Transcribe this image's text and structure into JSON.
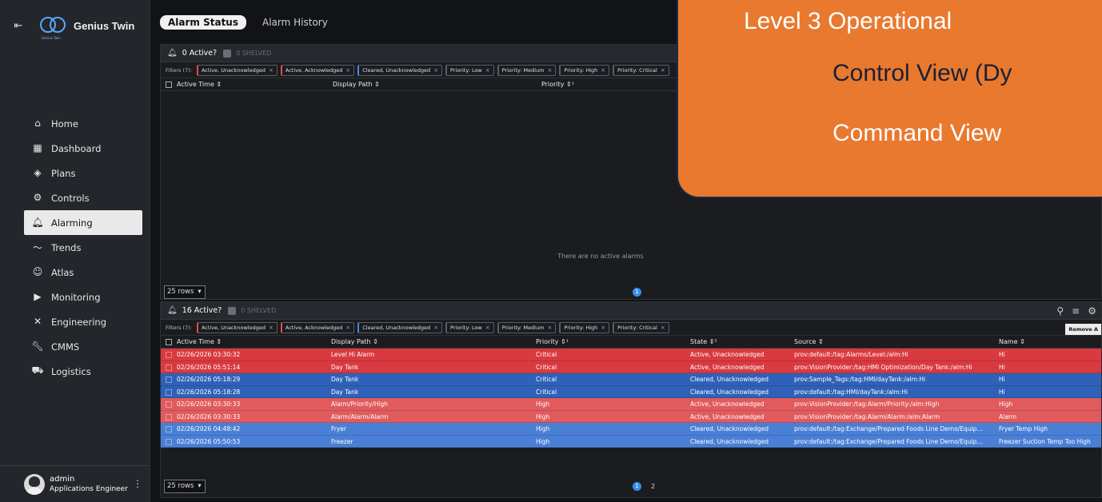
{
  "sidebar": {
    "collapse_icon": "arrow-left-icon",
    "brand": "Genius Twin",
    "logo_sub": "Genius Twin",
    "items": [
      {
        "label": "Home",
        "icon": "home-icon"
      },
      {
        "label": "Dashboard",
        "icon": "dashboard-icon"
      },
      {
        "label": "Plans",
        "icon": "layers-icon"
      },
      {
        "label": "Controls",
        "icon": "gears-icon"
      },
      {
        "label": "Alarming",
        "icon": "bell-icon",
        "active": true
      },
      {
        "label": "Trends",
        "icon": "trend-icon"
      },
      {
        "label": "Atlas",
        "icon": "users-icon"
      },
      {
        "label": "Monitoring",
        "icon": "camera-icon"
      },
      {
        "label": "Engineering",
        "icon": "tools-icon"
      },
      {
        "label": "CMMS",
        "icon": "wrench-icon"
      },
      {
        "label": "Logistics",
        "icon": "car-icon"
      }
    ],
    "user": {
      "name": "admin",
      "role": "Applications Engineer"
    }
  },
  "tabs": [
    {
      "label": "Alarm Status",
      "active": true
    },
    {
      "label": "Alarm History",
      "active": false
    }
  ],
  "panel1": {
    "active_label": "0 Active?",
    "shelved_label": "0 SHELVED",
    "filters_label": "Filters (7):",
    "chips": [
      "Active, Unacknowledged",
      "Active, Acknowledged",
      "Cleared, Unacknowledged",
      "Priority: Low",
      "Priority: Medium",
      "Priority: High",
      "Priority: Critical"
    ],
    "columns": [
      "Active Time",
      "Display Path",
      "Priority"
    ],
    "empty_message": "There are no active alarms",
    "rows_select": "25 rows",
    "pages": [
      "1"
    ]
  },
  "panel2": {
    "active_label": "16 Active?",
    "shelved_label": "0 SHELVED",
    "filters_label": "Filters (7):",
    "chips": [
      "Active, Unacknowledged",
      "Active, Acknowledged",
      "Cleared, Unacknowledged",
      "Priority: Low",
      "Priority: Medium",
      "Priority: High",
      "Priority: Critical"
    ],
    "remove_label": "Remove A",
    "columns": [
      "Active Time",
      "Display Path",
      "Priority",
      "State",
      "Source",
      "Name"
    ],
    "rows": [
      {
        "time": "02/26/2026 03:30:32",
        "path": "Level Hi Alarm",
        "priority": "Critical",
        "state": "Active, Unacknowledged",
        "source": "prov:default:/tag:Alarms/Level:/alm:Hi",
        "name": "Hi",
        "color": "#d93a3f"
      },
      {
        "time": "02/26/2026 05:51:14",
        "path": "Day Tank",
        "priority": "Critical",
        "state": "Active, Unacknowledged",
        "source": "prov:VisionProvider:/tag:HMI Optimization/Day Tank:/alm:Hi",
        "name": "Hi",
        "color": "#d93a3f"
      },
      {
        "time": "02/26/2026 05:18:29",
        "path": "Day Tank",
        "priority": "Critical",
        "state": "Cleared, Unacknowledged",
        "source": "prov:Sample_Tags:/tag:HMI/dayTank:/alm:Hi",
        "name": "Hi",
        "color": "#2f61b8"
      },
      {
        "time": "02/26/2026 05:18:28",
        "path": "Day Tank",
        "priority": "Critical",
        "state": "Cleared, Unacknowledged",
        "source": "prov:default:/tag:HMI/dayTank:/alm:Hi",
        "name": "Hi",
        "color": "#2f61b8"
      },
      {
        "time": "02/26/2026 03:30:33",
        "path": "Alarm/Priority/High",
        "priority": "High",
        "state": "Active, Unacknowledged",
        "source": "prov:VisionProvider:/tag:Alarm/Priority:/alm:High",
        "name": "High",
        "color": "#e05a5e"
      },
      {
        "time": "02/26/2026 03:30:33",
        "path": "Alarm/Alarm/Alarm",
        "priority": "High",
        "state": "Active, Unacknowledged",
        "source": "prov:VisionProvider:/tag:Alarm/Alarm:/alm:Alarm",
        "name": "Alarm",
        "color": "#e05a5e"
      },
      {
        "time": "02/26/2026 04:48:42",
        "path": "Fryer",
        "priority": "High",
        "state": "Cleared, Unacknowledged",
        "source": "prov:default:/tag:Exchange/Prepared Foods Line Demo/Equip...",
        "name": "Fryer Temp High",
        "color": "#4a7fd6"
      },
      {
        "time": "02/26/2026 05:50:53",
        "path": "Freezer",
        "priority": "High",
        "state": "Cleared, Unacknowledged",
        "source": "prov:default:/tag:Exchange/Prepared Foods Line Demo/Equip...",
        "name": "Freezer Suction Temp Too High",
        "color": "#4a7fd6"
      }
    ],
    "rows_select": "25 rows",
    "pages": [
      "1",
      "2"
    ]
  },
  "overlay": {
    "line1": "Level 3 Operational",
    "line2": "Control View (Dy",
    "line3": "Command View",
    "color": "#e8792f"
  }
}
